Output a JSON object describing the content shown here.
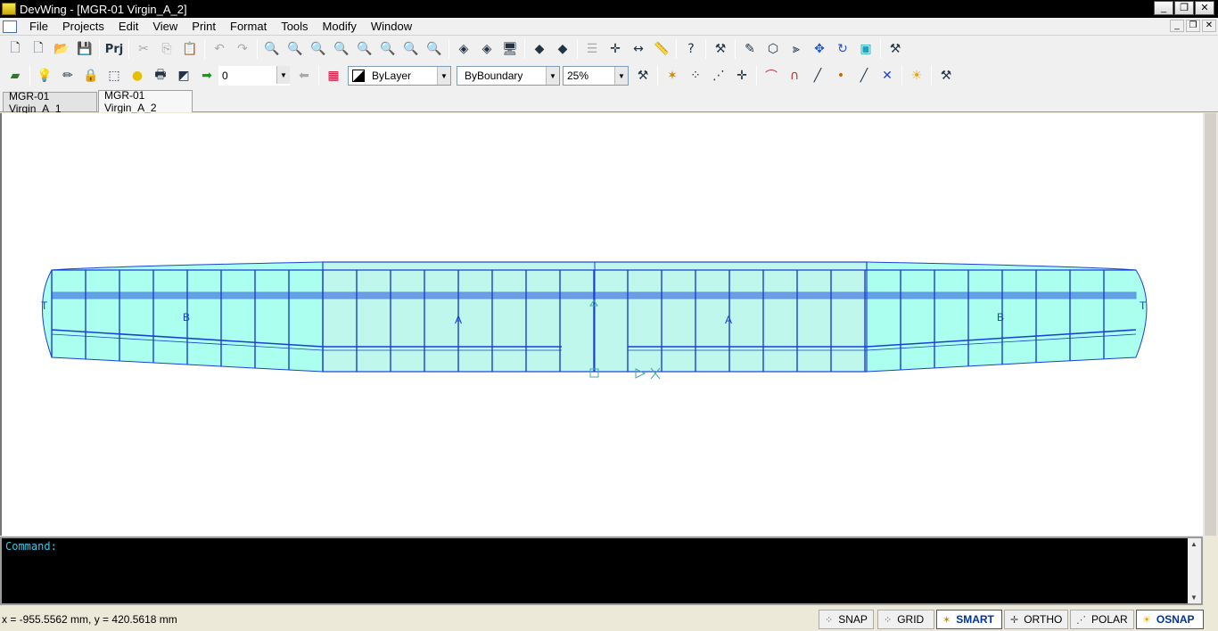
{
  "window": {
    "title": "DevWing - [MGR-01 Virgin_A_2]"
  },
  "menu": {
    "items": [
      "File",
      "Projects",
      "Edit",
      "View",
      "Print",
      "Format",
      "Tools",
      "Modify",
      "Window"
    ]
  },
  "toolbar": {
    "prj_label": "Prj",
    "layer_value": "0",
    "linetype_value": "ByLayer",
    "fill_value": "ByBoundary",
    "transparency_value": "25%"
  },
  "tabs": [
    {
      "label": "MGR-01 Virgin_A_1",
      "active": false
    },
    {
      "label": "MGR-01 Virgin_A_2",
      "active": true
    }
  ],
  "drawing": {
    "labels": [
      "T",
      "B",
      "A",
      "A",
      "B",
      "T"
    ]
  },
  "command": {
    "prompt": "Command:"
  },
  "status": {
    "coords": "x = -955.5562 mm, y = 420.5618 mm",
    "buttons": [
      {
        "label": "SNAP",
        "on": false
      },
      {
        "label": "GRID",
        "on": false
      },
      {
        "label": "SMART",
        "on": true
      },
      {
        "label": "ORTHO",
        "on": false
      },
      {
        "label": "POLAR",
        "on": false
      },
      {
        "label": "OSNAP",
        "on": true
      }
    ]
  },
  "colors": {
    "wing_fill": "#bff7ec",
    "wing_outer": "#aaffee",
    "wing_line": "#1a3fd6",
    "spar": "#2a55e0",
    "cmd_text": "#3ec8e8"
  }
}
